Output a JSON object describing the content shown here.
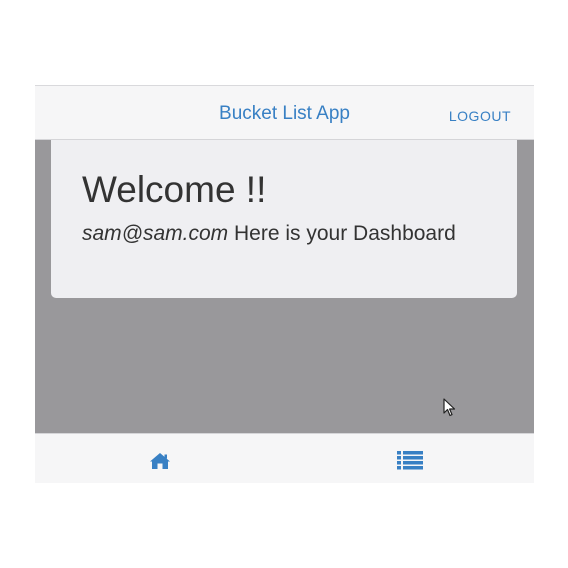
{
  "header": {
    "title": "Bucket List App",
    "logout_label": "LOGOUT"
  },
  "dashboard": {
    "heading": "Welcome !!",
    "user_email": "sam@sam.com",
    "message": " Here is your Dashboard"
  },
  "tabs": [
    {
      "icon": "home-icon"
    },
    {
      "icon": "list-icon"
    }
  ],
  "colors": {
    "accent": "#3880c4",
    "content_background": "#99989b",
    "card_background": "#efeff2",
    "bar_background": "#f6f6f7",
    "text": "#333333"
  }
}
